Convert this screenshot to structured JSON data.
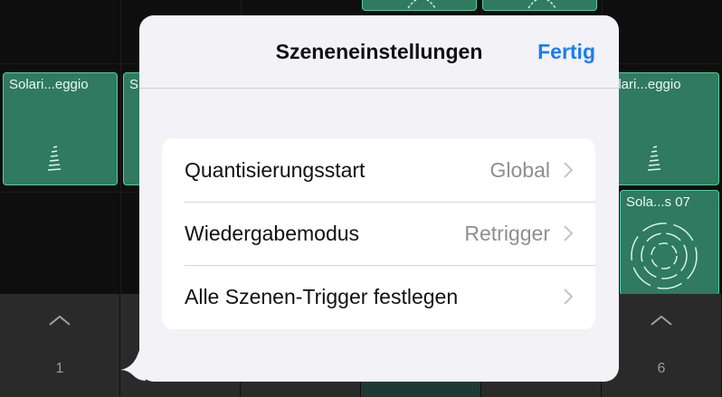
{
  "background": {
    "clips": [
      {
        "label": "Solari...eggio"
      },
      {
        "label": "S"
      },
      {
        "label": "olari...eggio"
      },
      {
        "label": "Sola...s 07"
      }
    ],
    "scene_numbers": [
      "1",
      "6"
    ]
  },
  "popover": {
    "title": "Szeneneinstellungen",
    "done_label": "Fertig",
    "rows": [
      {
        "label": "Quantisierungsstart",
        "value": "Global"
      },
      {
        "label": "Wiedergabemodus",
        "value": "Retrigger"
      },
      {
        "label": "Alle Szenen-Trigger festlegen",
        "value": ""
      }
    ]
  },
  "colors": {
    "accent": "#1a7cf5",
    "clip_fill": "#2f7a61",
    "clip_border": "#4fd0a0"
  }
}
